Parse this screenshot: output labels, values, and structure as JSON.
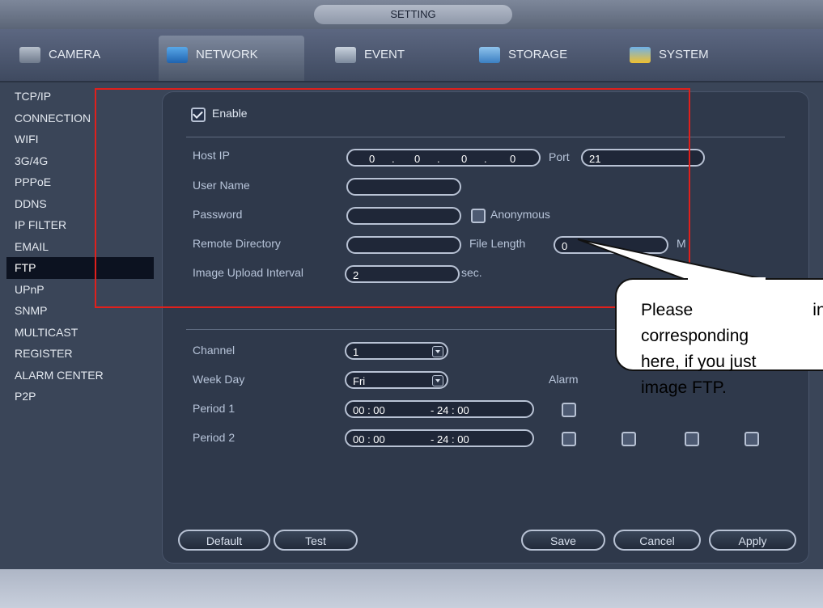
{
  "window": {
    "title": "SETTING"
  },
  "tabs": [
    {
      "label": "CAMERA",
      "icon": "camera-icon"
    },
    {
      "label": "NETWORK",
      "icon": "network-icon"
    },
    {
      "label": "EVENT",
      "icon": "event-icon"
    },
    {
      "label": "STORAGE",
      "icon": "storage-icon"
    },
    {
      "label": "SYSTEM",
      "icon": "system-icon"
    }
  ],
  "sidebar": {
    "items": [
      {
        "label": "TCP/IP"
      },
      {
        "label": "CONNECTION"
      },
      {
        "label": "WIFI"
      },
      {
        "label": "3G/4G"
      },
      {
        "label": "PPPoE"
      },
      {
        "label": "DDNS"
      },
      {
        "label": "IP FILTER"
      },
      {
        "label": "EMAIL"
      },
      {
        "label": "FTP"
      },
      {
        "label": "UPnP"
      },
      {
        "label": "SNMP"
      },
      {
        "label": "MULTICAST"
      },
      {
        "label": "REGISTER"
      },
      {
        "label": "ALARM CENTER"
      },
      {
        "label": "P2P"
      }
    ],
    "active": "FTP"
  },
  "ftp": {
    "enable_label": "Enable",
    "enable_checked": true,
    "host_ip_label": "Host IP",
    "host_ip": [
      "0",
      "0",
      "0",
      "0"
    ],
    "host_ip_sep": ".",
    "port_label": "Port",
    "port_value": "21",
    "username_label": "User Name",
    "username_value": "",
    "password_label": "Password",
    "password_value": "",
    "anonymous_label": "Anonymous",
    "anonymous_checked": false,
    "remote_dir_label": "Remote Directory",
    "remote_dir_value": "",
    "file_length_label": "File Length",
    "file_length_value": "0",
    "file_length_unit": "M",
    "upload_interval_label": "Image Upload Interval",
    "upload_interval_value": "2",
    "upload_interval_unit": "sec.",
    "channel_label": "Channel",
    "channel_value": "1",
    "weekday_label": "Week Day",
    "weekday_value": "Fri",
    "alarm_label": "Alarm",
    "period1_label": "Period 1",
    "period1_start": "00 : 00",
    "period1_end": "- 24 : 00",
    "period2_label": "Period 2",
    "period2_start": "00 : 00",
    "period2_end": "- 24 : 00"
  },
  "buttons": {
    "default": "Default",
    "test": "Test",
    "save": "Save",
    "cancel": "Cancel",
    "apply": "Apply"
  },
  "callout": {
    "line1a": "Please",
    "line1b": "inpu",
    "line2": "corresponding",
    "line3": "here, if you just",
    "line4": "image FTP."
  },
  "colors": {
    "annotation_box": "#e0201c",
    "active_sidebar": "#0c1220"
  }
}
